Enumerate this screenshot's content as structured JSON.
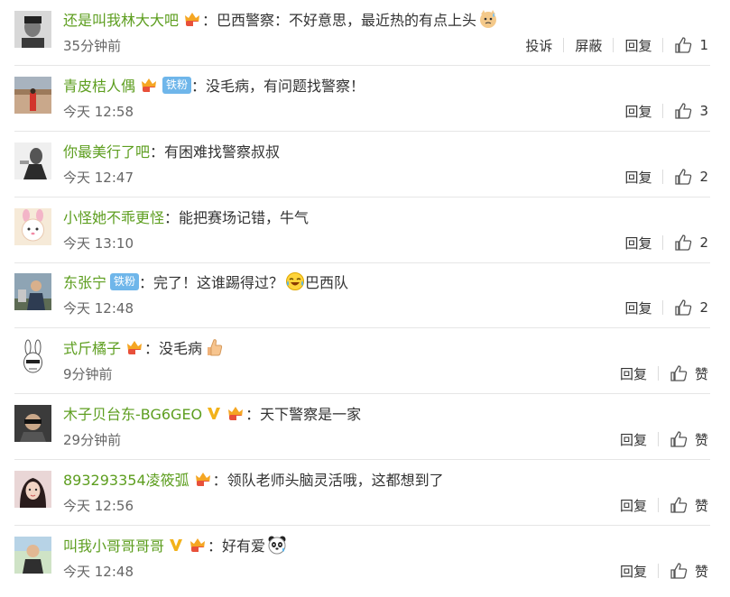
{
  "actions": {
    "report": "投诉",
    "block": "屏蔽",
    "reply": "回复",
    "like_word": "赞"
  },
  "comments": [
    {
      "user": "还是叫我林大大吧",
      "text": "：巴西警察：不好意思，最近热的有点上头",
      "time": "35分钟前",
      "likes": "1",
      "vip": true,
      "tie": false,
      "v": false,
      "emoji": "cat-sweat-emoji",
      "has_report": true
    },
    {
      "user": "青皮桔人偶",
      "text": "：没毛病，有问题找警察！",
      "time": "今天 12:58",
      "likes": "3",
      "vip": true,
      "tie": true,
      "tie_label": "铁粉",
      "v": false,
      "emoji": "",
      "has_report": false
    },
    {
      "user": "你最美行了吧",
      "text": "：有困难找警察叔叔",
      "time": "今天 12:47",
      "likes": "2",
      "vip": false,
      "tie": false,
      "v": false,
      "emoji": "",
      "has_report": false
    },
    {
      "user": "小怪她不乖更怪",
      "text": "：能把赛场记错，牛气",
      "time": "今天 13:10",
      "likes": "2",
      "vip": false,
      "tie": false,
      "v": false,
      "emoji": "",
      "has_report": false
    },
    {
      "user": "东张宁",
      "text_before": "：完了！这谁踢得过？",
      "text": "巴西队",
      "time": "今天 12:48",
      "likes": "2",
      "vip": false,
      "tie": true,
      "tie_label": "铁粉",
      "v": false,
      "emoji": "laugh-cry-emoji",
      "has_report": false
    },
    {
      "user": "式斤橘子",
      "text": "：没毛病",
      "time": "9分钟前",
      "likes": "赞",
      "vip": true,
      "tie": false,
      "v": false,
      "emoji": "thumbs-up-emoji",
      "has_report": false
    },
    {
      "user": "木子贝台东-BG6GEO",
      "text": "：天下警察是一家",
      "time": "29分钟前",
      "likes": "赞",
      "vip": true,
      "tie": false,
      "v": true,
      "emoji": "",
      "has_report": false
    },
    {
      "user": "893293354凌筱弧",
      "text": "：领队老师头脑灵活哦，这都想到了",
      "time": "今天 12:56",
      "likes": "赞",
      "vip": true,
      "tie": false,
      "v": false,
      "emoji": "",
      "has_report": false
    },
    {
      "user": "叫我小哥哥哥哥",
      "text": "：好有爱",
      "time": "今天 12:48",
      "likes": "赞",
      "vip": true,
      "tie": false,
      "v": true,
      "emoji": "panda-emoji",
      "has_report": false
    }
  ]
}
